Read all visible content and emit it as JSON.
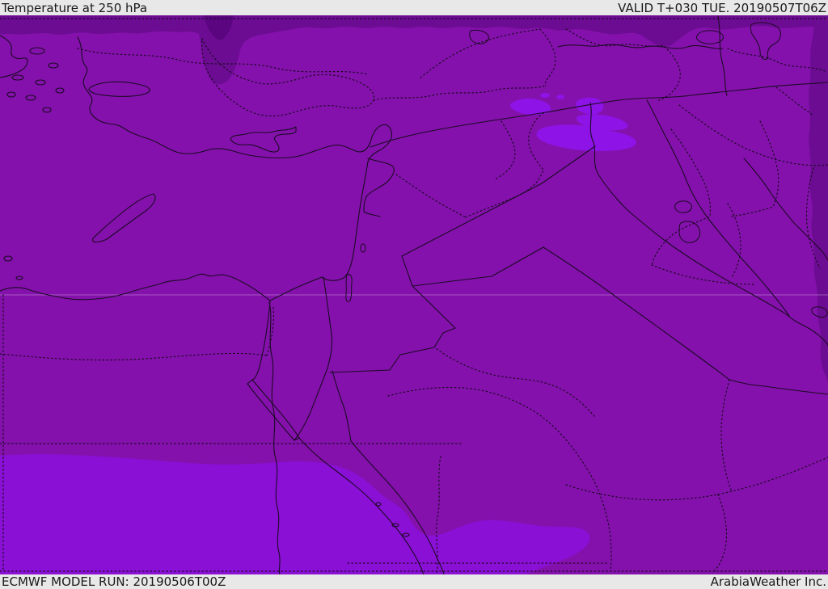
{
  "header": {
    "title": "Temperature at 250 hPa",
    "valid_time": "VALID T+030 TUE. 20190507T06Z"
  },
  "footer": {
    "model_run": "ECMWF MODEL RUN: 20190506T00Z",
    "brand": "ArabiaWeather Inc."
  },
  "map": {
    "colors": {
      "bar_bg": "#E8E8E8",
      "bar_text": "#1A1A1A",
      "base": "#8411AC",
      "cold_band": "#6C0C92",
      "cold_core": "#5B0680",
      "warm_band": "#8A10D6",
      "warm_blob": "#8E13E6",
      "line": "#1C0A24",
      "grid_line": "rgba(255,255,255,0.3)"
    }
  }
}
